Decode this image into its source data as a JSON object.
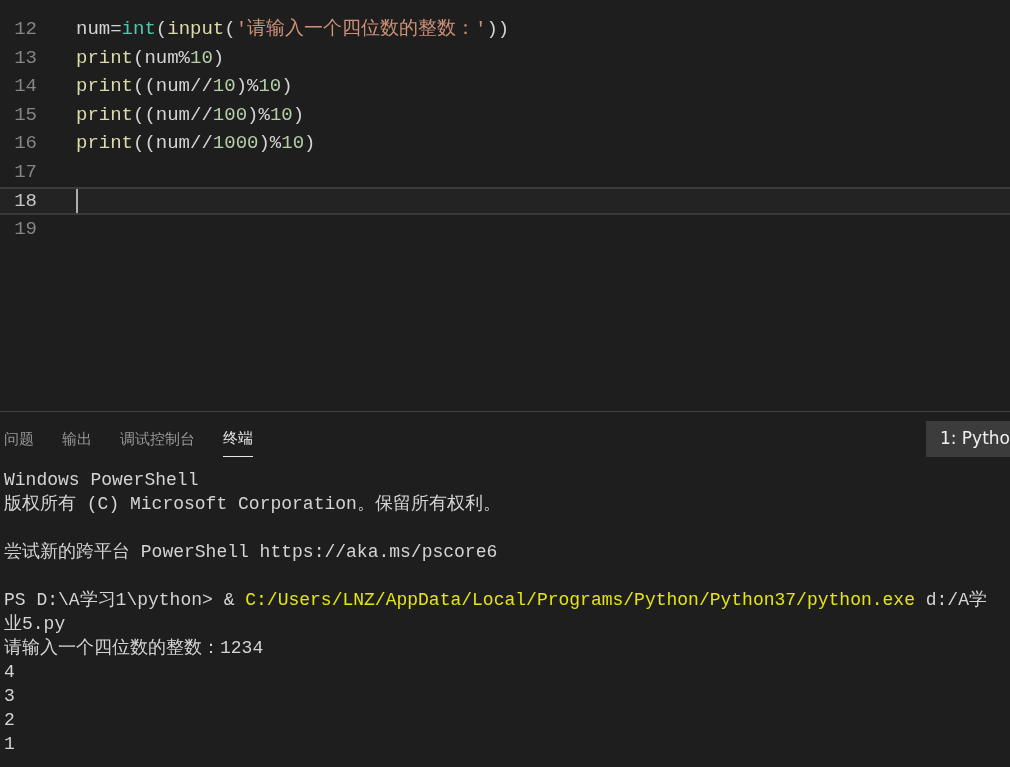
{
  "editor": {
    "lines": [
      {
        "number": "12",
        "current": false,
        "tokens": [
          {
            "kind": "plain",
            "text": "num="
          },
          {
            "kind": "builtin",
            "text": "int"
          },
          {
            "kind": "plain",
            "text": "("
          },
          {
            "kind": "function",
            "text": "input"
          },
          {
            "kind": "plain",
            "text": "("
          },
          {
            "kind": "string",
            "text": "'请输入一个四位数的整数：'"
          },
          {
            "kind": "plain",
            "text": "))"
          }
        ]
      },
      {
        "number": "13",
        "current": false,
        "tokens": [
          {
            "kind": "function",
            "text": "print"
          },
          {
            "kind": "plain",
            "text": "(num%"
          },
          {
            "kind": "number",
            "text": "10"
          },
          {
            "kind": "plain",
            "text": ")"
          }
        ]
      },
      {
        "number": "14",
        "current": false,
        "tokens": [
          {
            "kind": "function",
            "text": "print"
          },
          {
            "kind": "plain",
            "text": "((num//"
          },
          {
            "kind": "number",
            "text": "10"
          },
          {
            "kind": "plain",
            "text": ")%"
          },
          {
            "kind": "number",
            "text": "10"
          },
          {
            "kind": "plain",
            "text": ")"
          }
        ]
      },
      {
        "number": "15",
        "current": false,
        "tokens": [
          {
            "kind": "function",
            "text": "print"
          },
          {
            "kind": "plain",
            "text": "((num//"
          },
          {
            "kind": "number",
            "text": "100"
          },
          {
            "kind": "plain",
            "text": ")%"
          },
          {
            "kind": "number",
            "text": "10"
          },
          {
            "kind": "plain",
            "text": ")"
          }
        ]
      },
      {
        "number": "16",
        "current": false,
        "tokens": [
          {
            "kind": "function",
            "text": "print"
          },
          {
            "kind": "plain",
            "text": "((num//"
          },
          {
            "kind": "number",
            "text": "1000"
          },
          {
            "kind": "plain",
            "text": ")%"
          },
          {
            "kind": "number",
            "text": "10"
          },
          {
            "kind": "plain",
            "text": ")"
          }
        ]
      },
      {
        "number": "17",
        "current": false
      },
      {
        "number": "18",
        "current": true
      },
      {
        "number": "19",
        "current": false
      }
    ]
  },
  "panel": {
    "tabs": [
      {
        "label": "问题",
        "selected": false
      },
      {
        "label": "输出",
        "selected": false
      },
      {
        "label": "调试控制台",
        "selected": false
      },
      {
        "label": "终端",
        "selected": true
      }
    ],
    "terminal_selector": "1: Pytho",
    "terminal_blocks": [
      [
        [
          {
            "kind": "plain",
            "text": "Windows PowerShell"
          }
        ],
        [
          {
            "kind": "plain",
            "text": "版权所有 (C) Microsoft Corporation。保留所有权利。"
          }
        ]
      ],
      [
        [
          {
            "kind": "plain",
            "text": "尝试新的跨平台 PowerShell https://aka.ms/pscore6"
          }
        ]
      ],
      [
        [
          {
            "kind": "plain",
            "text": "PS D:\\A学习1\\python> & "
          },
          {
            "kind": "path",
            "text": "C:/Users/LNZ/AppData/Local/Programs/Python/Python37/python.exe"
          },
          {
            "kind": "plain",
            "text": " d:/A学"
          }
        ],
        [
          {
            "kind": "plain",
            "text": "业5.py"
          }
        ],
        [
          {
            "kind": "plain",
            "text": "请输入一个四位数的整数：1234"
          }
        ],
        [
          {
            "kind": "plain",
            "text": "4"
          }
        ],
        [
          {
            "kind": "plain",
            "text": "3"
          }
        ],
        [
          {
            "kind": "plain",
            "text": "2"
          }
        ],
        [
          {
            "kind": "plain",
            "text": "1"
          }
        ]
      ]
    ]
  }
}
